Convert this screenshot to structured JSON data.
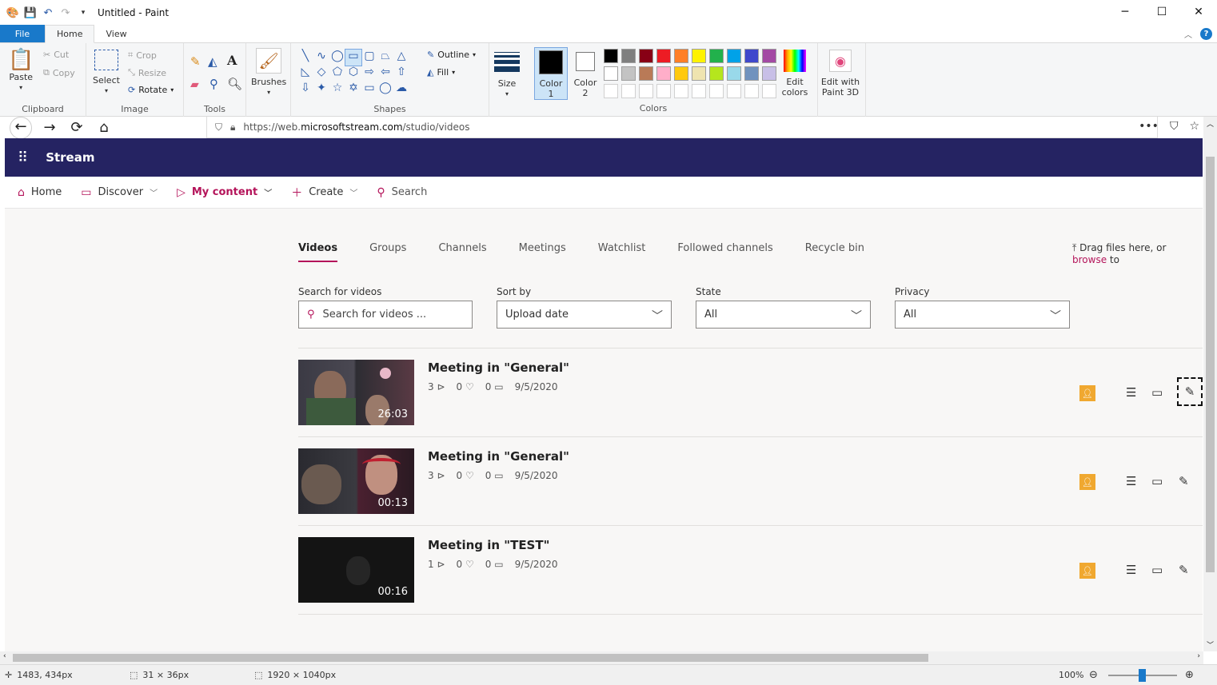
{
  "paint": {
    "title": "Untitled - Paint",
    "menu": {
      "file": "File",
      "home": "Home",
      "view": "View"
    },
    "clipboard": {
      "paste": "Paste",
      "cut": "Cut",
      "copy": "Copy",
      "label": "Clipboard"
    },
    "image": {
      "select": "Select",
      "crop": "Crop",
      "resize": "Resize",
      "rotate": "Rotate",
      "label": "Image"
    },
    "tools": {
      "label": "Tools"
    },
    "brushes": {
      "label": "Brushes"
    },
    "shapes": {
      "label": "Shapes",
      "outline": "Outline",
      "fill": "Fill"
    },
    "size": {
      "label": "Size"
    },
    "color1": {
      "label": "Color",
      "num": "1"
    },
    "color2": {
      "label": "Color",
      "num": "2"
    },
    "colors": {
      "label": "Colors",
      "edit_l1": "Edit",
      "edit_l2": "colors"
    },
    "paint3d": {
      "l1": "Edit with",
      "l2": "Paint 3D"
    },
    "palette": [
      "#000000",
      "#7f7f7f",
      "#880015",
      "#ed1c24",
      "#ff7f27",
      "#fff200",
      "#22b14c",
      "#00a2e8",
      "#3f48cc",
      "#a349a4",
      "#ffffff",
      "#c3c3c3",
      "#b97a57",
      "#ffaec9",
      "#ffc90e",
      "#efe4b0",
      "#b5e61d",
      "#99d9ea",
      "#7092be",
      "#c8bfe7"
    ],
    "status": {
      "pos": "1483, 434px",
      "sel": "31 × 36px",
      "size": "1920 × 1040px",
      "zoom": "100%"
    }
  },
  "browser": {
    "url_prefix": "https://web.",
    "url_domain": "microsoftstream.com",
    "url_path": "/studio/videos"
  },
  "stream": {
    "brand": "Stream",
    "nav": {
      "home": "Home",
      "discover": "Discover",
      "mycontent": "My content",
      "create": "Create",
      "search": "Search"
    },
    "tabs": [
      "Videos",
      "Groups",
      "Channels",
      "Meetings",
      "Watchlist",
      "Followed channels",
      "Recycle bin"
    ],
    "drag": {
      "text": "Drag files here, or",
      "link": "browse",
      "tail": "to"
    },
    "filters": {
      "search_label": "Search for videos",
      "search_placeholder": "Search for videos ...",
      "sort_label": "Sort by",
      "sort_value": "Upload date",
      "state_label": "State",
      "state_value": "All",
      "privacy_label": "Privacy",
      "privacy_value": "All"
    },
    "videos": [
      {
        "title": "Meeting in \"General\"",
        "views": "3",
        "likes": "0",
        "comments": "0",
        "date": "9/5/2020",
        "duration": "26:03"
      },
      {
        "title": "Meeting in \"General\"",
        "views": "3",
        "likes": "0",
        "comments": "0",
        "date": "9/5/2020",
        "duration": "00:13"
      },
      {
        "title": "Meeting in \"TEST\"",
        "views": "1",
        "likes": "0",
        "comments": "0",
        "date": "9/5/2020",
        "duration": "00:16"
      }
    ]
  }
}
